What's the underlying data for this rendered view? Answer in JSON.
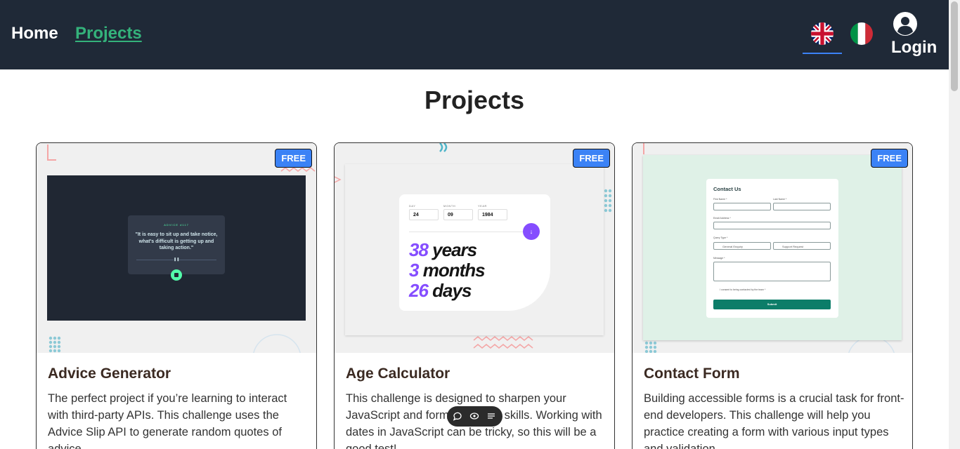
{
  "header": {
    "nav": {
      "home": "Home",
      "projects": "Projects"
    },
    "languages": [
      "English",
      "Italiano"
    ],
    "active_language": "English",
    "login": "Login"
  },
  "page": {
    "title": "Projects"
  },
  "cards": [
    {
      "badge": "FREE",
      "title": "Advice Generator",
      "description": "The perfect project if you’re learning to interact with third-party APIs. This challenge uses the Advice Slip API to generate random quotes of advice.",
      "preview": {
        "label": "ADVICE #117",
        "quote": "\"It is easy to sit up and take notice, what's difficult is getting up and taking action.\"",
        "pause": "❚❚"
      }
    },
    {
      "badge": "FREE",
      "title": "Age Calculator",
      "description": "This challenge is designed to sharpen your JavaScript and form validation skills. Working with dates in JavaScript can be tricky, so this will be a good test!",
      "preview": {
        "day_label": "DAY",
        "day": "24",
        "month_label": "MONTH",
        "month": "09",
        "year_label": "YEAR",
        "year": "1984",
        "years_num": "38",
        "years_word": "years",
        "months_num": "3",
        "months_word": "months",
        "days_num": "26",
        "days_word": "days",
        "arrow": "↓"
      }
    },
    {
      "badge": "FREE",
      "title": "Contact Form",
      "description": "Building accessible forms is a crucial task for front-end developers. This challenge will help you practice creating a form with various input types and validation.",
      "preview": {
        "title": "Contact Us",
        "first_name": "First Name *",
        "last_name": "Last Name *",
        "email": "Email Address *",
        "query_type": "Query Type *",
        "general": "General Enquiry",
        "support": "Support Request",
        "message": "Message *",
        "consent": "I consent to being contacted by the team *",
        "submit": "Submit"
      }
    }
  ],
  "colors": {
    "header_bg": "#1f2937",
    "active_nav": "#34b27b",
    "badge": "#3b82f6",
    "accent_purple": "#854dff"
  },
  "icons": [
    "uk-flag-icon",
    "italy-flag-icon",
    "user-circle-icon",
    "comment-icon",
    "eye-icon",
    "list-icon"
  ]
}
